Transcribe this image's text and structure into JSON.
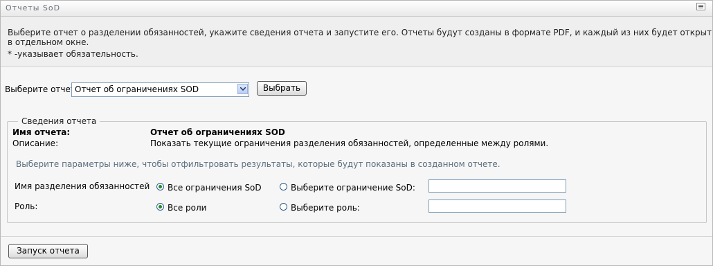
{
  "window": {
    "title": "Отчеты SoD",
    "menu_icon": "window-menu-icon"
  },
  "intro": {
    "description": "Выберите отчет о разделении обязанностей, укажите сведения отчета и запустите его. Отчеты будут созданы в формате PDF, и каждый из них будет открыт в отдельном окне.",
    "required_note": "* -указывает обязательность."
  },
  "report_select": {
    "label": "Выберите отчет:",
    "selected": "Отчет об ограничениях SOD",
    "button": "Выбрать"
  },
  "details": {
    "legend": "Сведения отчета",
    "name_label": "Имя отчета:",
    "name_value": "Отчет об ограничениях SOD",
    "description_label": "Описание:",
    "description_value": "Показать текущие ограничения разделения обязанностей, определенные между ролями.",
    "filter_hint": "Выберите параметры ниже, чтобы отфильтровать результаты, которые будут показаны в созданном отчете.",
    "params": [
      {
        "label": "Имя разделения обязанностей",
        "option_all": "Все ограничения SoD",
        "option_select": "Выберите ограничение SoD:",
        "value": ""
      },
      {
        "label": "Роль:",
        "option_all": "Все роли",
        "option_select": "Выберите роль:",
        "value": ""
      }
    ]
  },
  "footer": {
    "run_button": "Запуск отчета"
  }
}
